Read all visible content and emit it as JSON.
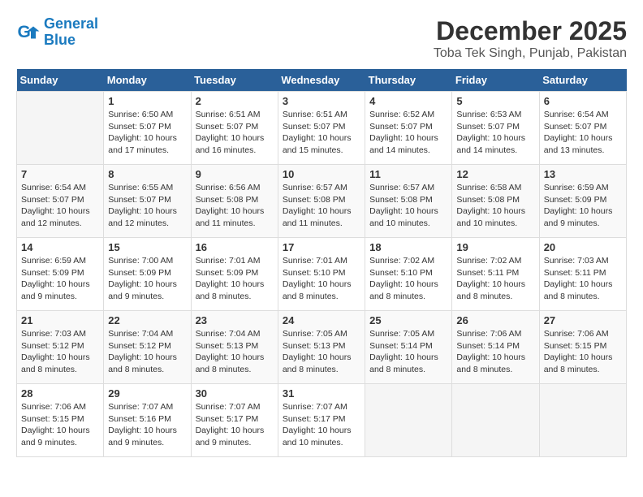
{
  "header": {
    "logo_line1": "General",
    "logo_line2": "Blue",
    "month": "December 2025",
    "location": "Toba Tek Singh, Punjab, Pakistan"
  },
  "days_of_week": [
    "Sunday",
    "Monday",
    "Tuesday",
    "Wednesday",
    "Thursday",
    "Friday",
    "Saturday"
  ],
  "weeks": [
    [
      {
        "day": "",
        "info": ""
      },
      {
        "day": "1",
        "info": "Sunrise: 6:50 AM\nSunset: 5:07 PM\nDaylight: 10 hours\nand 17 minutes."
      },
      {
        "day": "2",
        "info": "Sunrise: 6:51 AM\nSunset: 5:07 PM\nDaylight: 10 hours\nand 16 minutes."
      },
      {
        "day": "3",
        "info": "Sunrise: 6:51 AM\nSunset: 5:07 PM\nDaylight: 10 hours\nand 15 minutes."
      },
      {
        "day": "4",
        "info": "Sunrise: 6:52 AM\nSunset: 5:07 PM\nDaylight: 10 hours\nand 14 minutes."
      },
      {
        "day": "5",
        "info": "Sunrise: 6:53 AM\nSunset: 5:07 PM\nDaylight: 10 hours\nand 14 minutes."
      },
      {
        "day": "6",
        "info": "Sunrise: 6:54 AM\nSunset: 5:07 PM\nDaylight: 10 hours\nand 13 minutes."
      }
    ],
    [
      {
        "day": "7",
        "info": "Sunrise: 6:54 AM\nSunset: 5:07 PM\nDaylight: 10 hours\nand 12 minutes."
      },
      {
        "day": "8",
        "info": "Sunrise: 6:55 AM\nSunset: 5:07 PM\nDaylight: 10 hours\nand 12 minutes."
      },
      {
        "day": "9",
        "info": "Sunrise: 6:56 AM\nSunset: 5:08 PM\nDaylight: 10 hours\nand 11 minutes."
      },
      {
        "day": "10",
        "info": "Sunrise: 6:57 AM\nSunset: 5:08 PM\nDaylight: 10 hours\nand 11 minutes."
      },
      {
        "day": "11",
        "info": "Sunrise: 6:57 AM\nSunset: 5:08 PM\nDaylight: 10 hours\nand 10 minutes."
      },
      {
        "day": "12",
        "info": "Sunrise: 6:58 AM\nSunset: 5:08 PM\nDaylight: 10 hours\nand 10 minutes."
      },
      {
        "day": "13",
        "info": "Sunrise: 6:59 AM\nSunset: 5:09 PM\nDaylight: 10 hours\nand 9 minutes."
      }
    ],
    [
      {
        "day": "14",
        "info": "Sunrise: 6:59 AM\nSunset: 5:09 PM\nDaylight: 10 hours\nand 9 minutes."
      },
      {
        "day": "15",
        "info": "Sunrise: 7:00 AM\nSunset: 5:09 PM\nDaylight: 10 hours\nand 9 minutes."
      },
      {
        "day": "16",
        "info": "Sunrise: 7:01 AM\nSunset: 5:09 PM\nDaylight: 10 hours\nand 8 minutes."
      },
      {
        "day": "17",
        "info": "Sunrise: 7:01 AM\nSunset: 5:10 PM\nDaylight: 10 hours\nand 8 minutes."
      },
      {
        "day": "18",
        "info": "Sunrise: 7:02 AM\nSunset: 5:10 PM\nDaylight: 10 hours\nand 8 minutes."
      },
      {
        "day": "19",
        "info": "Sunrise: 7:02 AM\nSunset: 5:11 PM\nDaylight: 10 hours\nand 8 minutes."
      },
      {
        "day": "20",
        "info": "Sunrise: 7:03 AM\nSunset: 5:11 PM\nDaylight: 10 hours\nand 8 minutes."
      }
    ],
    [
      {
        "day": "21",
        "info": "Sunrise: 7:03 AM\nSunset: 5:12 PM\nDaylight: 10 hours\nand 8 minutes."
      },
      {
        "day": "22",
        "info": "Sunrise: 7:04 AM\nSunset: 5:12 PM\nDaylight: 10 hours\nand 8 minutes."
      },
      {
        "day": "23",
        "info": "Sunrise: 7:04 AM\nSunset: 5:13 PM\nDaylight: 10 hours\nand 8 minutes."
      },
      {
        "day": "24",
        "info": "Sunrise: 7:05 AM\nSunset: 5:13 PM\nDaylight: 10 hours\nand 8 minutes."
      },
      {
        "day": "25",
        "info": "Sunrise: 7:05 AM\nSunset: 5:14 PM\nDaylight: 10 hours\nand 8 minutes."
      },
      {
        "day": "26",
        "info": "Sunrise: 7:06 AM\nSunset: 5:14 PM\nDaylight: 10 hours\nand 8 minutes."
      },
      {
        "day": "27",
        "info": "Sunrise: 7:06 AM\nSunset: 5:15 PM\nDaylight: 10 hours\nand 8 minutes."
      }
    ],
    [
      {
        "day": "28",
        "info": "Sunrise: 7:06 AM\nSunset: 5:15 PM\nDaylight: 10 hours\nand 9 minutes."
      },
      {
        "day": "29",
        "info": "Sunrise: 7:07 AM\nSunset: 5:16 PM\nDaylight: 10 hours\nand 9 minutes."
      },
      {
        "day": "30",
        "info": "Sunrise: 7:07 AM\nSunset: 5:17 PM\nDaylight: 10 hours\nand 9 minutes."
      },
      {
        "day": "31",
        "info": "Sunrise: 7:07 AM\nSunset: 5:17 PM\nDaylight: 10 hours\nand 10 minutes."
      },
      {
        "day": "",
        "info": ""
      },
      {
        "day": "",
        "info": ""
      },
      {
        "day": "",
        "info": ""
      }
    ]
  ]
}
